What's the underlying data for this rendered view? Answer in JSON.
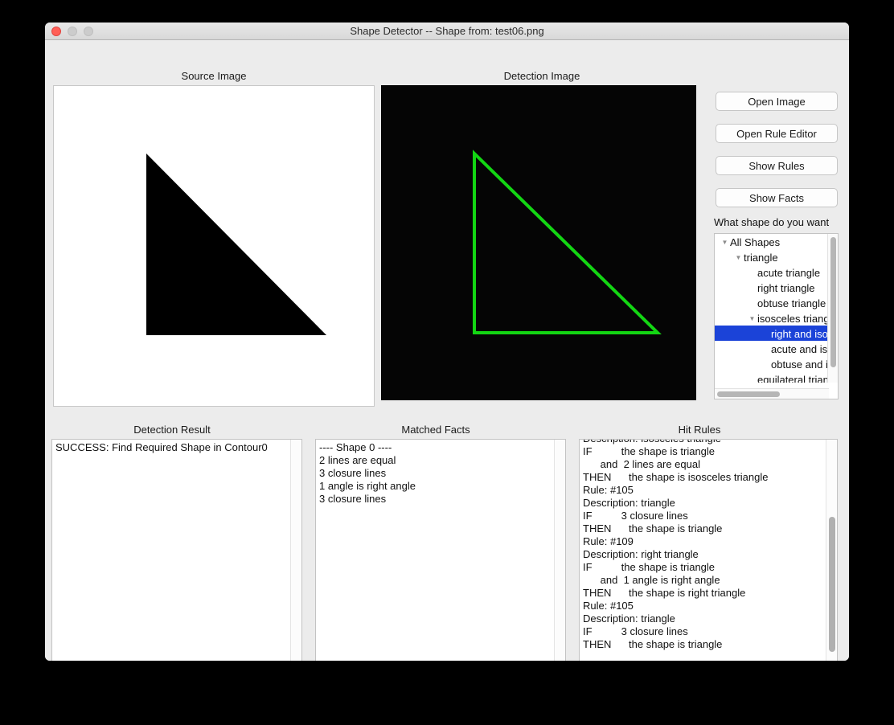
{
  "window": {
    "title": "Shape Detector -- Shape from: test06.png",
    "traffic_lights": [
      "close-button",
      "minimize-button",
      "maximize-button"
    ]
  },
  "panels": {
    "source_image_title": "Source Image",
    "detection_image_title": "Detection Image",
    "detection_result_title": "Detection Result",
    "matched_facts_title": "Matched Facts",
    "hit_rules_title": "Hit Rules"
  },
  "images": {
    "source": {
      "background": "#ffffff",
      "shape_color": "#000000",
      "shape": "right-triangle-filled"
    },
    "detection": {
      "background": "#000000",
      "shape_color": "#13d613",
      "shape": "right-triangle-outline"
    }
  },
  "buttons": [
    {
      "label": "Open Image",
      "name": "open-image-button"
    },
    {
      "label": "Open Rule Editor",
      "name": "open-rule-editor-button"
    },
    {
      "label": "Show Rules",
      "name": "show-rules-button"
    },
    {
      "label": "Show Facts",
      "name": "show-facts-button"
    }
  ],
  "shape_selector": {
    "label": "What shape do you want",
    "tree": [
      {
        "label": "All Shapes",
        "depth": 0,
        "expanded": true,
        "selected": false
      },
      {
        "label": "triangle",
        "depth": 1,
        "expanded": true,
        "selected": false
      },
      {
        "label": "acute triangle",
        "depth": 2,
        "expanded": null,
        "selected": false
      },
      {
        "label": "right triangle",
        "depth": 2,
        "expanded": null,
        "selected": false
      },
      {
        "label": "obtuse triangle",
        "depth": 2,
        "expanded": null,
        "selected": false
      },
      {
        "label": "isosceles triangle",
        "depth": 2,
        "expanded": true,
        "selected": false
      },
      {
        "label": "right and isosceles triangle",
        "depth": 3,
        "expanded": null,
        "selected": true
      },
      {
        "label": "acute and isosceles triangle",
        "depth": 3,
        "expanded": null,
        "selected": false
      },
      {
        "label": "obtuse and isosceles triangle",
        "depth": 3,
        "expanded": null,
        "selected": false
      },
      {
        "label": "equilateral triangle",
        "depth": 2,
        "expanded": null,
        "selected": false
      }
    ],
    "selected_color": "#1b43d8"
  },
  "detection_result": {
    "lines": [
      "SUCCESS: Find Required Shape in Contour0"
    ]
  },
  "matched_facts": {
    "lines": [
      "---- Shape 0 ----",
      "2 lines are equal",
      "3 closure lines",
      "1 angle is right angle",
      "3 closure lines"
    ]
  },
  "hit_rules": {
    "lines": [
      "Description: isosceles triangle",
      "IF          the shape is triangle",
      "      and  2 lines are equal",
      "THEN      the shape is isosceles triangle",
      "Rule: #105",
      "Description: triangle",
      "IF          3 closure lines",
      "THEN      the shape is triangle",
      "Rule: #109",
      "Description: right triangle",
      "IF          the shape is triangle",
      "      and  1 angle is right angle",
      "THEN      the shape is right triangle",
      "Rule: #105",
      "Description: triangle",
      "IF          3 closure lines",
      "THEN      the shape is triangle"
    ],
    "scrolled": true
  }
}
